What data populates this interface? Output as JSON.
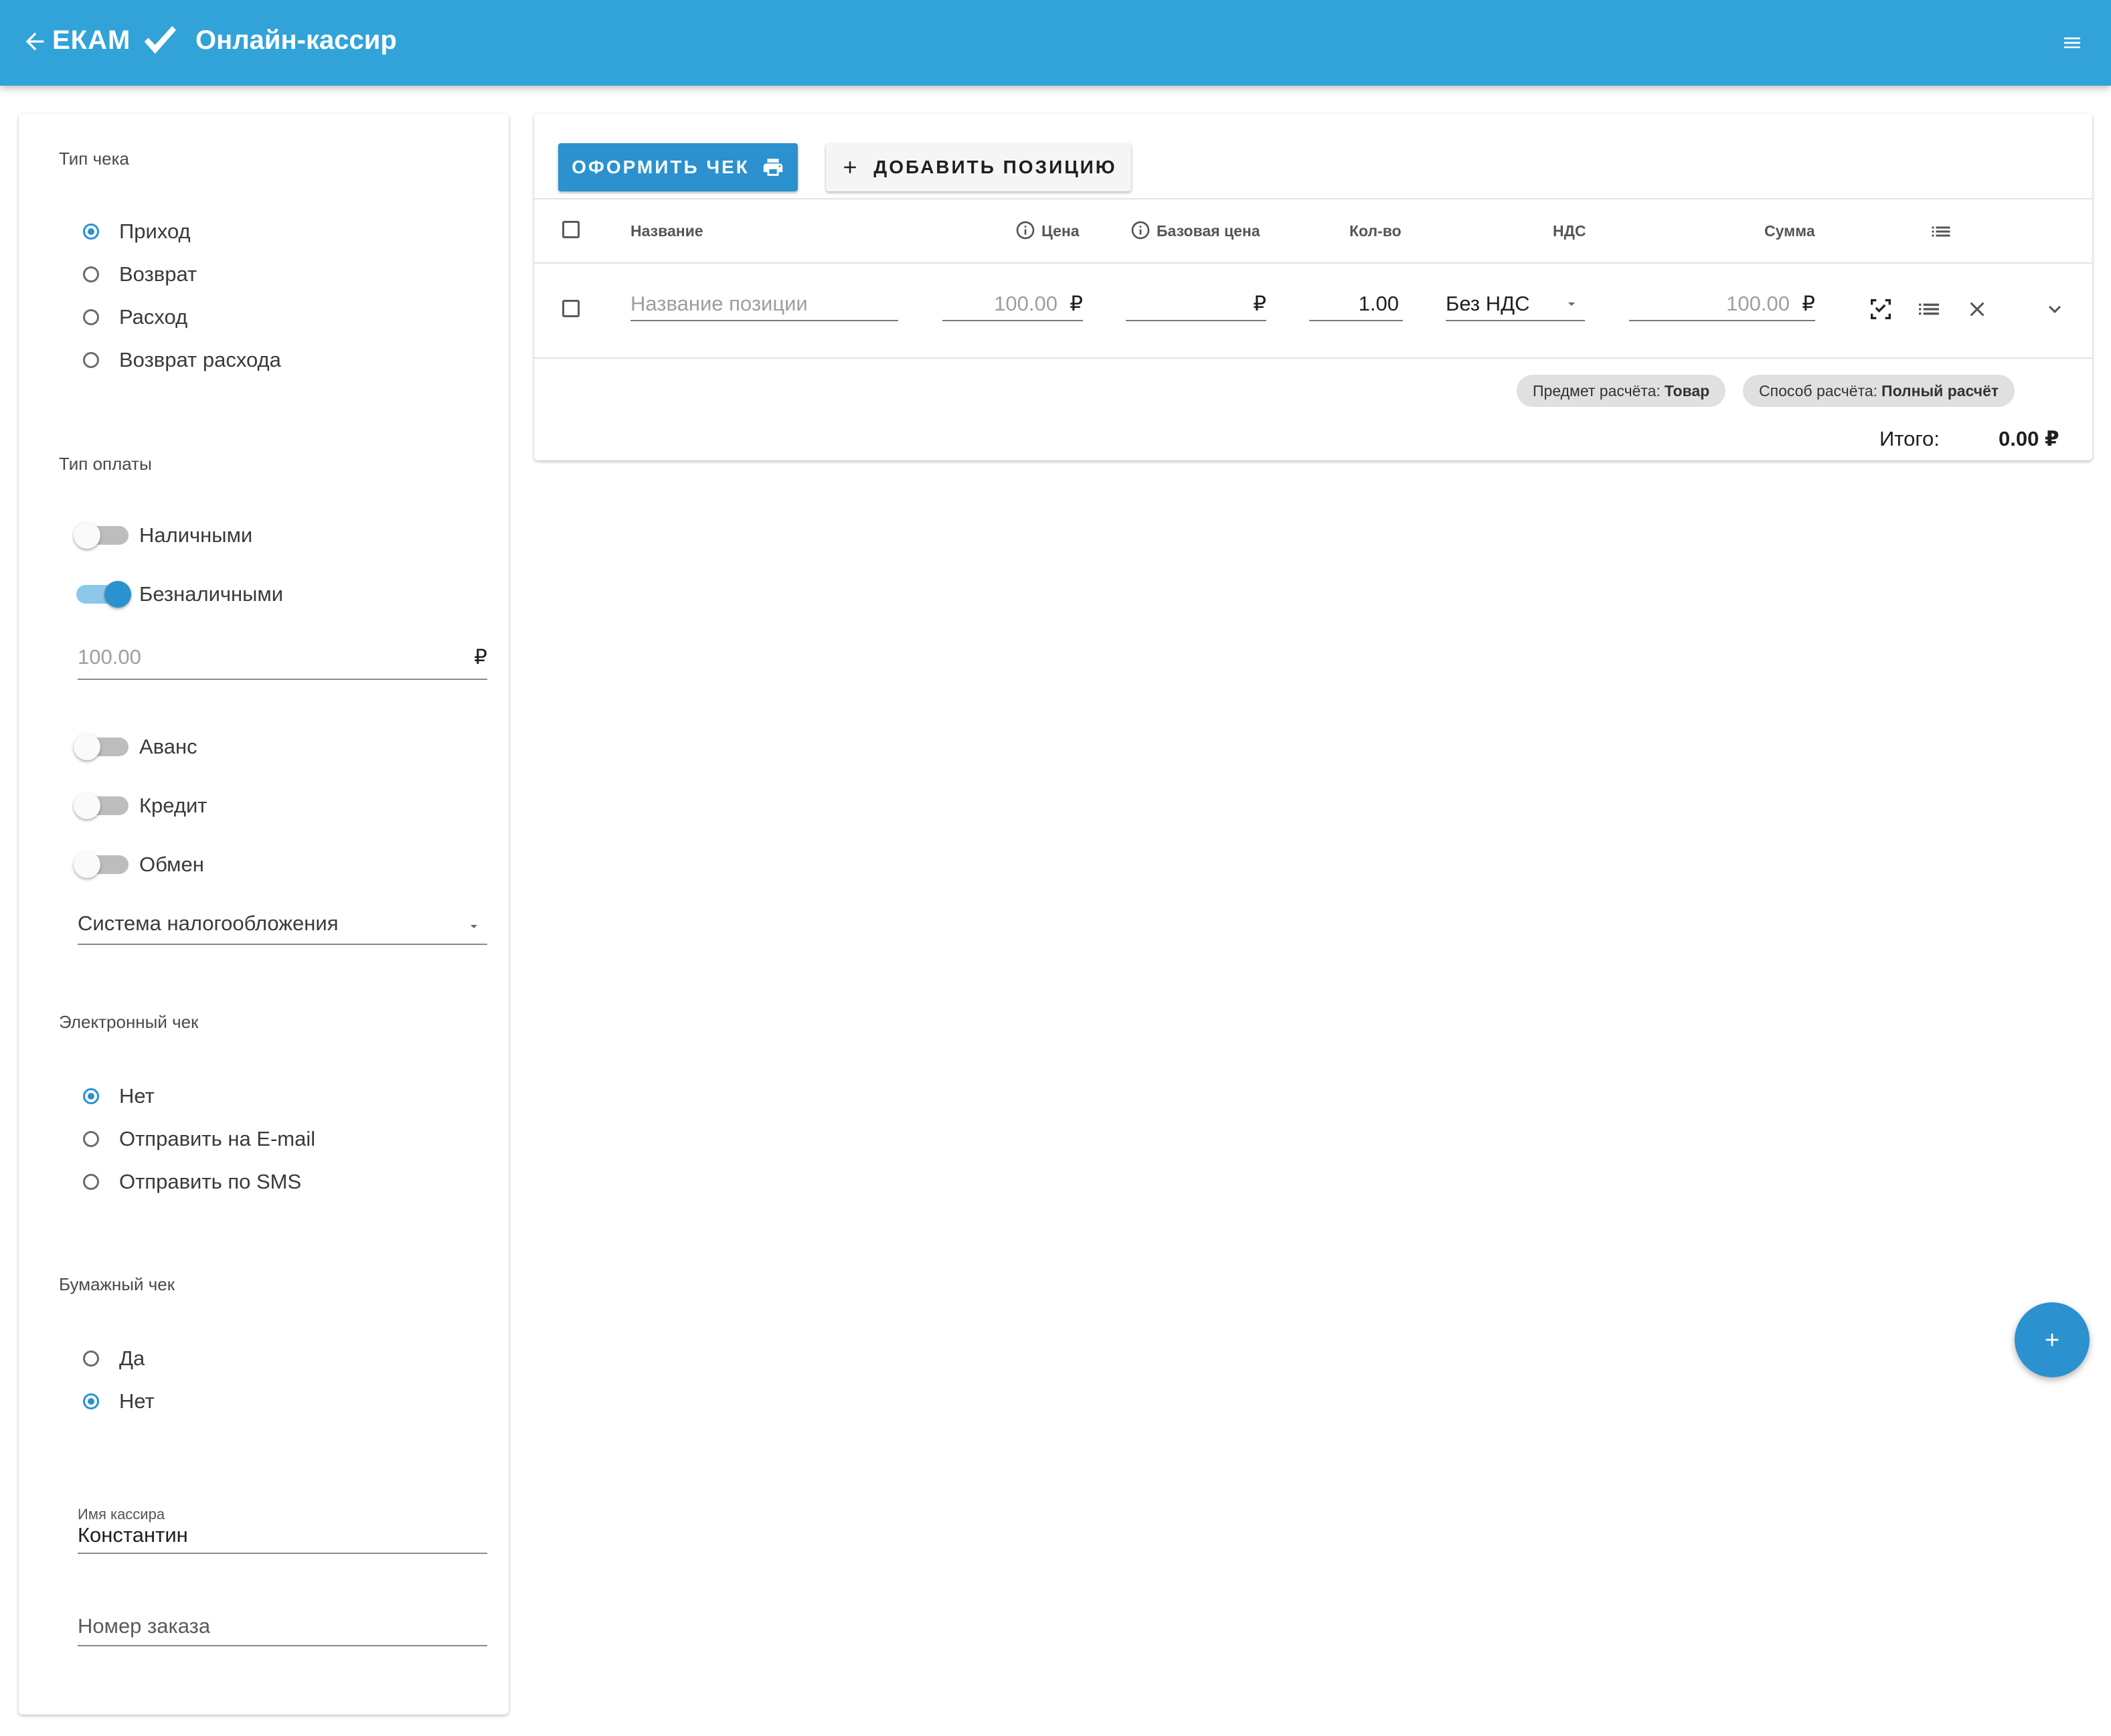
{
  "header": {
    "brand": "ЕКАМ",
    "title": "Онлайн-кассир"
  },
  "sidebar": {
    "receipt_type": {
      "title": "Тип чека",
      "options": [
        "Приход",
        "Возврат",
        "Расход",
        "Возврат расхода"
      ],
      "selected": "Приход"
    },
    "payment_type": {
      "title": "Тип оплаты",
      "cash": {
        "label": "Наличными",
        "on": false
      },
      "cashless": {
        "label": "Безналичными",
        "on": true
      },
      "amount_placeholder": "100.00",
      "currency": "₽",
      "advance": {
        "label": "Аванс",
        "on": false
      },
      "credit": {
        "label": "Кредит",
        "on": false
      },
      "exchange": {
        "label": "Обмен",
        "on": false
      },
      "tax_system_placeholder": "Система налогообложения"
    },
    "e_receipt": {
      "title": "Электронный чек",
      "options": [
        "Нет",
        "Отправить на E-mail",
        "Отправить по SMS"
      ],
      "selected": "Нет"
    },
    "paper_receipt": {
      "title": "Бумажный чек",
      "options": [
        "Да",
        "Нет"
      ],
      "selected": "Нет"
    },
    "cashier": {
      "label": "Имя кассира",
      "value": "Константин"
    },
    "order": {
      "placeholder": "Номер заказа"
    }
  },
  "toolbar": {
    "issue_label": "ОФОРМИТЬ ЧЕК",
    "add_label": "ДОБАВИТЬ ПОЗИЦИЮ"
  },
  "table": {
    "headers": {
      "name": "Название",
      "price": "Цена",
      "base_price": "Базовая цена",
      "qty": "Кол-во",
      "vat": "НДС",
      "sum": "Сумма"
    },
    "row": {
      "name_placeholder": "Название позиции",
      "price_placeholder": "100.00",
      "currency": "₽",
      "qty": "1.00",
      "vat": "Без НДС",
      "sum_placeholder": "100.00"
    },
    "chips": {
      "subject_label": "Предмет расчёта:",
      "subject_value": "Товар",
      "method_label": "Способ расчёта:",
      "method_value": "Полный расчёт"
    },
    "total_label": "Итого:",
    "total_value": "0.00 ₽"
  },
  "colors": {
    "appbar": "#31a3d9",
    "accent": "#2b91cf"
  }
}
